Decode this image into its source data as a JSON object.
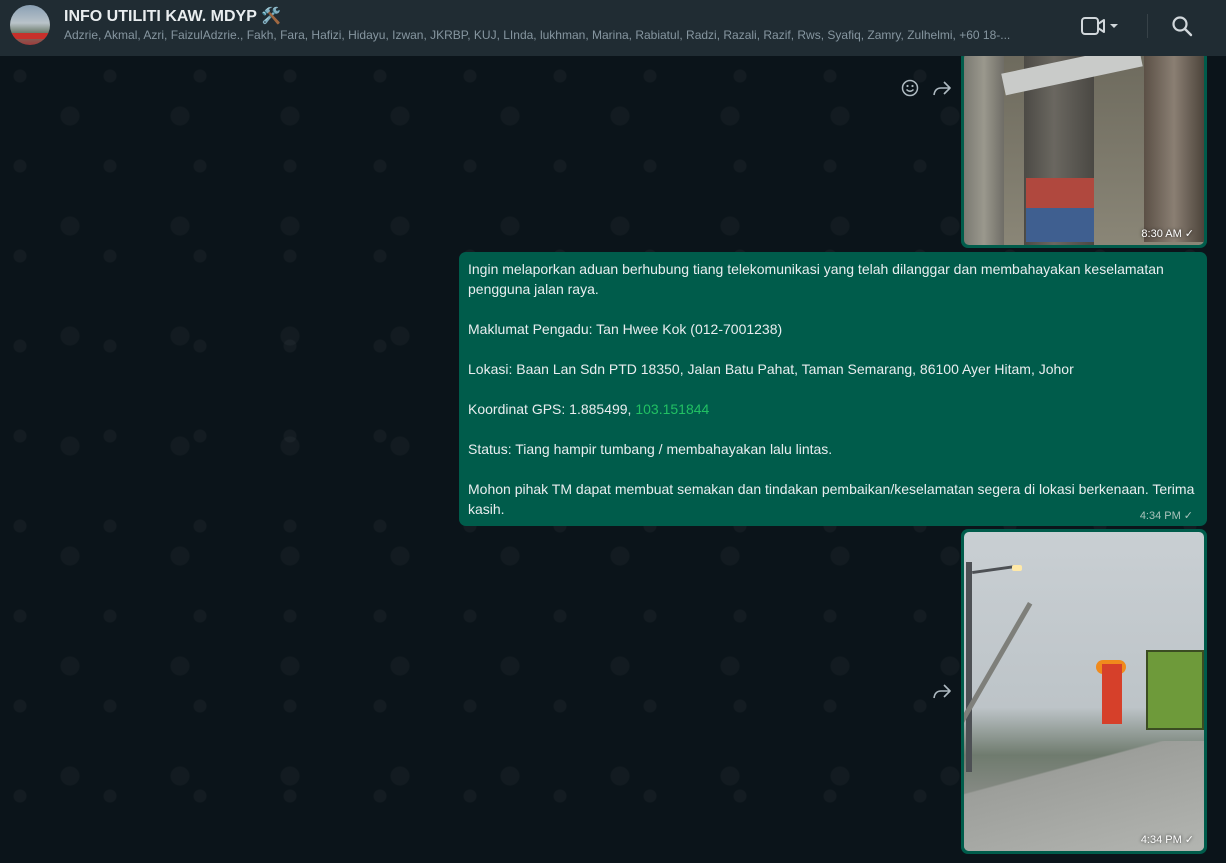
{
  "header": {
    "title": "INFO UTILITI KAW. MDYP 🛠️",
    "participants": "Adzrie, Akmal, Azri, FaizulAdzrie., Fakh, Fara, Hafizi, Hidayu, Izwan, JKRBP, KUJ, LInda, lukhman, Marina, Rabiatul, Radzi, Razali, Razif, Rws, Syafiq, Zamry, Zulhelmi, +60 18-..."
  },
  "messages": [
    {
      "type": "image",
      "time": "8:30 AM",
      "status": "✓"
    },
    {
      "type": "text",
      "paragraphs": [
        "Ingin melaporkan aduan berhubung tiang telekomunikasi yang telah dilanggar dan membahayakan keselamatan pengguna jalan raya.",
        "Maklumat Pengadu: Tan Hwee Kok (012-7001238)",
        "Lokasi: Baan Lan Sdn PTD 18350, Jalan Batu Pahat, Taman Semarang, 86100 Ayer Hitam, Johor",
        "Status: Tiang hampir tumbang / membahayakan lalu lintas.",
        "Mohon pihak TM dapat membuat semakan dan tindakan pembaikan/keselamatan segera di lokasi berkenaan. Terima kasih."
      ],
      "gps_prefix": "Koordinat GPS: 1.885499, ",
      "gps_link": "103.151844",
      "time": "4:34 PM",
      "status": "✓"
    },
    {
      "type": "image",
      "time": "4:34 PM",
      "status": "✓"
    }
  ],
  "icons": {
    "emoji": "emoji-icon",
    "forward": "forward-icon",
    "video": "video-call-icon",
    "search": "search-icon"
  },
  "colors": {
    "header_bg": "#202c33",
    "chat_bg": "#0b141a",
    "outgoing_bubble": "#005c4b",
    "link": "#21c063"
  }
}
